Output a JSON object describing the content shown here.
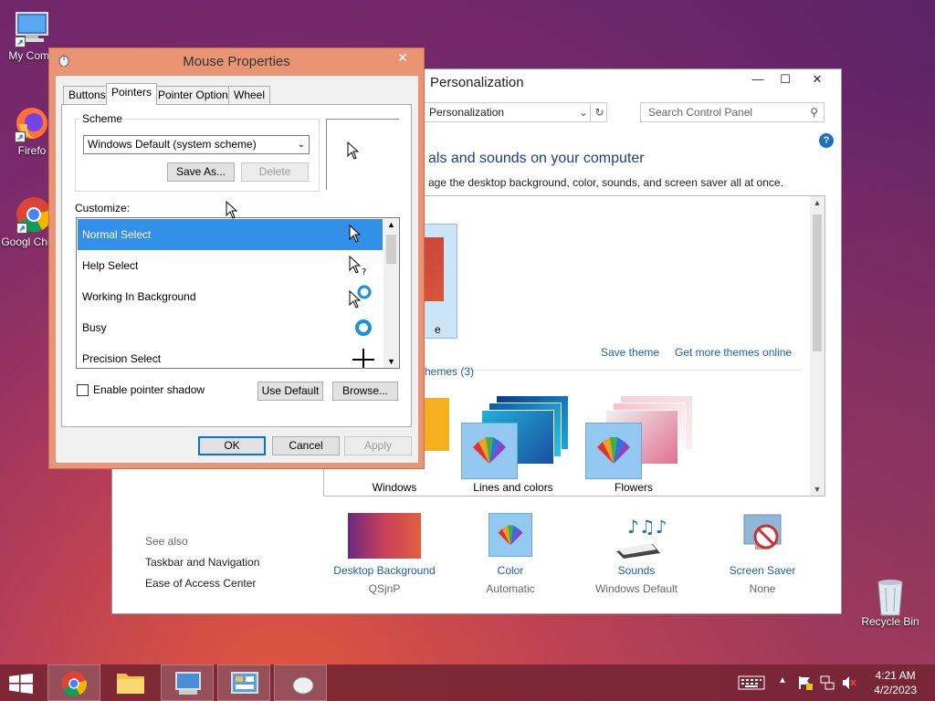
{
  "desktop": {
    "icons": [
      {
        "label": "My Comp"
      },
      {
        "label": "Firefo"
      },
      {
        "label": "Googl Chrom"
      },
      {
        "label": "Recycle Bin"
      }
    ]
  },
  "personalization": {
    "title": "Personalization",
    "address": "Personalization",
    "search_placeholder": "Search Control Panel",
    "heading": "als and sounds on your computer",
    "subheading": "age the desktop background, color, sounds, and screen saver all at once.",
    "selected_theme_fragment": "e",
    "save_theme": "Save theme",
    "get_more_themes": "Get more themes online",
    "installed_themes": "hemes (3)",
    "themes": [
      {
        "label": "Windows"
      },
      {
        "label": "Lines and colors"
      },
      {
        "label": "Flowers"
      }
    ],
    "see_also": {
      "heading": "See also",
      "links": [
        "Taskbar and Navigation",
        "Ease of Access Center"
      ]
    },
    "bottom": [
      {
        "title": "Desktop Background",
        "value": "QSjnP"
      },
      {
        "title": "Color",
        "value": "Automatic"
      },
      {
        "title": "Sounds",
        "value": "Windows Default"
      },
      {
        "title": "Screen Saver",
        "value": "None"
      }
    ]
  },
  "mouse": {
    "title": "Mouse Properties",
    "tabs": [
      "Buttons",
      "Pointers",
      "Pointer Options",
      "Wheel"
    ],
    "active_tab": "Pointers",
    "scheme_label": "Scheme",
    "scheme_value": "Windows Default (system scheme)",
    "save_as": "Save As...",
    "delete": "Delete",
    "customize_label": "Customize:",
    "pointers": [
      {
        "name": "Normal Select",
        "selected": true
      },
      {
        "name": "Help Select",
        "selected": false
      },
      {
        "name": "Working In Background",
        "selected": false
      },
      {
        "name": "Busy",
        "selected": false
      },
      {
        "name": "Precision Select",
        "selected": false
      }
    ],
    "enable_shadow": "Enable pointer shadow",
    "enable_shadow_checked": false,
    "use_default": "Use Default",
    "browse": "Browse...",
    "ok": "OK",
    "cancel": "Cancel",
    "apply": "Apply"
  },
  "taskbar": {
    "time": "4:21 AM",
    "date": "4/2/2023"
  },
  "colors": {
    "accent": "#3390e8",
    "dialog_frame": "#e99574",
    "link": "#1a5fb4"
  }
}
